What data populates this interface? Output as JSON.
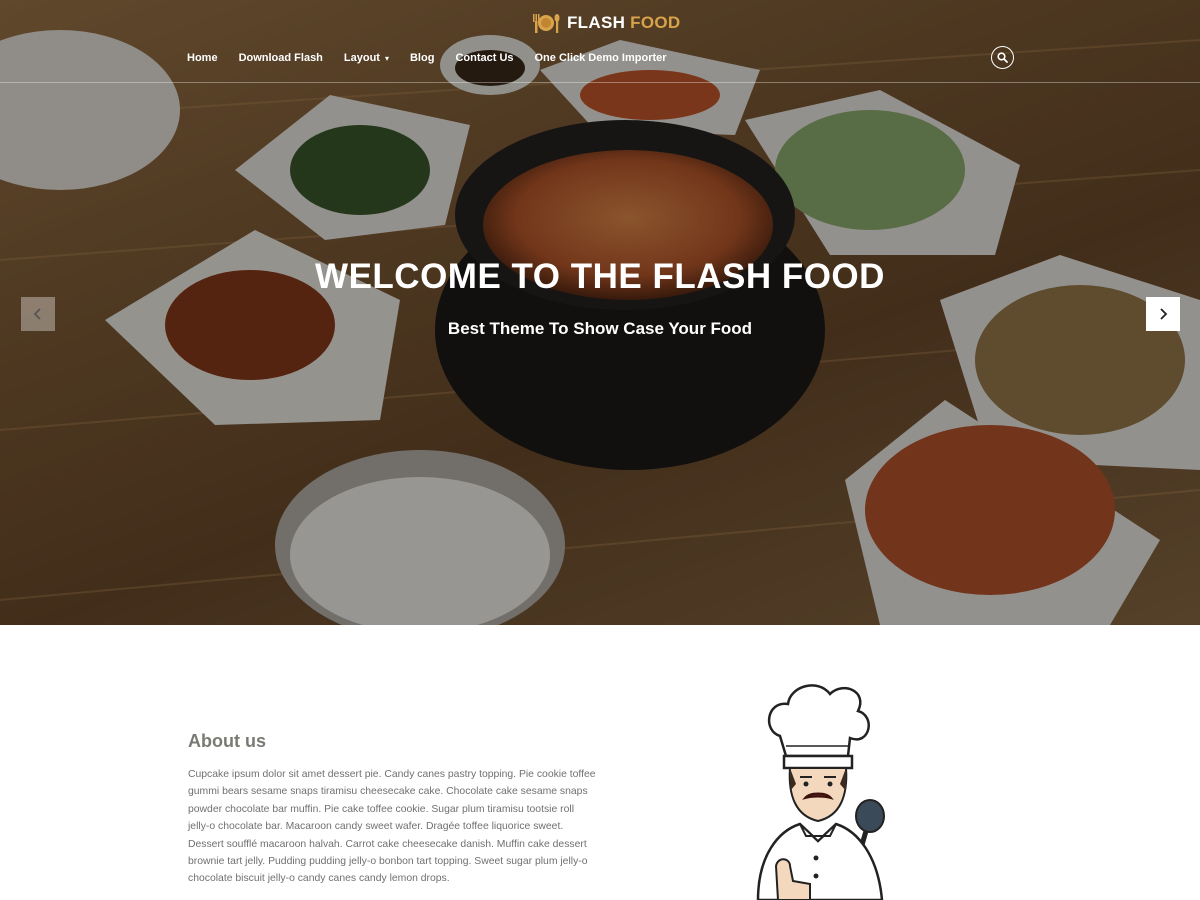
{
  "brand": {
    "word1": "FLASH",
    "word2": "FOOD",
    "accent_color": "#d8a34a",
    "icon": "fork-plate-spoon-icon"
  },
  "nav": {
    "items": [
      {
        "label": "Home",
        "has_dropdown": false
      },
      {
        "label": "Download Flash",
        "has_dropdown": false
      },
      {
        "label": "Layout",
        "has_dropdown": true
      },
      {
        "label": "Blog",
        "has_dropdown": false
      },
      {
        "label": "Contact Us",
        "has_dropdown": false
      },
      {
        "label": "One Click Demo Importer",
        "has_dropdown": false
      }
    ],
    "search_icon": "search-icon"
  },
  "hero": {
    "title": "WELCOME TO THE FLASH FOOD",
    "subtitle": "Best Theme To Show Case Your Food",
    "prev_icon": "chevron-left-icon",
    "next_icon": "chevron-right-icon"
  },
  "about": {
    "heading": "About us",
    "text": "Cupcake ipsum dolor sit amet dessert pie. Candy canes pastry topping. Pie cookie toffee gummi bears sesame snaps tiramisu cheesecake cake. Chocolate cake sesame snaps powder chocolate bar muffin. Pie cake toffee cookie. Sugar plum tiramisu tootsie roll jelly-o chocolate bar. Macaroon candy sweet wafer. Dragée toffee liquorice sweet. Dessert soufflé macaroon halvah. Carrot cake cheesecake danish. Muffin cake dessert brownie tart jelly. Pudding pudding jelly-o bonbon tart topping. Sweet sugar plum jelly-o chocolate biscuit jelly-o candy canes candy lemon drops."
  }
}
